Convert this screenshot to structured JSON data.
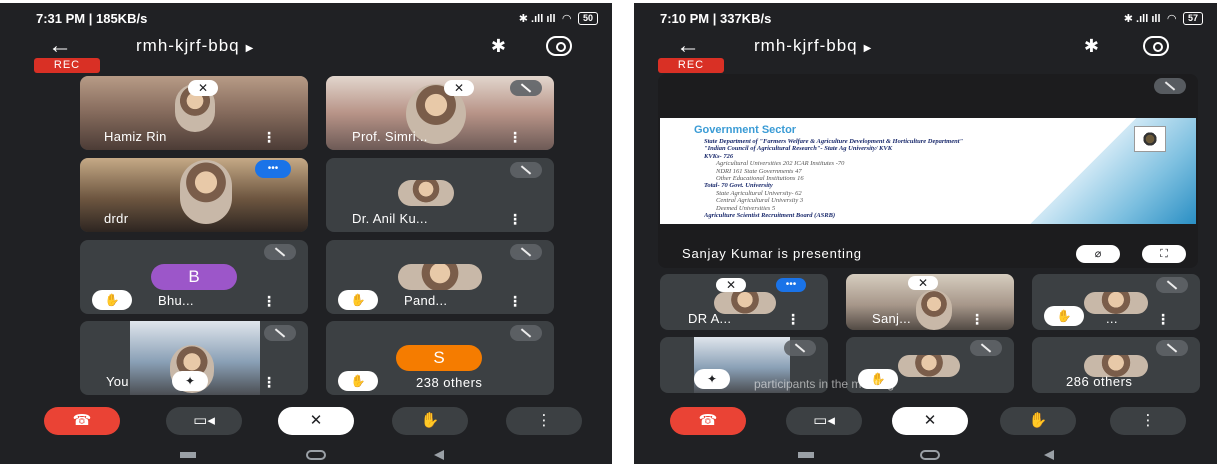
{
  "left_phone": {
    "status": {
      "time": "7:31 PM | 185KB/s",
      "network": "VoLTE",
      "battery": "50"
    },
    "header": {
      "meeting_code": "rmh-kjrf-bbq"
    },
    "rec_label": "REC",
    "tiles": [
      {
        "name": "Hamiz Rin"
      },
      {
        "name": "Prof. Simri..."
      },
      {
        "name": "drdr"
      },
      {
        "name": "Dr. Anil Ku..."
      },
      {
        "name": "Bhu...",
        "initial": "B"
      },
      {
        "name": "Pand..."
      },
      {
        "name": "You"
      },
      {
        "initial": "S",
        "others": "238 others"
      }
    ]
  },
  "right_phone": {
    "status": {
      "time": "7:10 PM | 337KB/s",
      "network": "VoLTE",
      "battery": "57"
    },
    "header": {
      "meeting_code": "rmh-kjrf-bbq"
    },
    "rec_label": "REC",
    "presentation": {
      "presenter_text": "Sanjay Kumar is presenting",
      "slide": {
        "title": "Government Sector",
        "lines": [
          {
            "text": "State Department of \"Farmers Welfare & Agriculture Development & Horticulture Department\"",
            "kind": "main"
          },
          {
            "text": "\"Indian Council of Agricultural Research\"- State Ag University/ KVK",
            "kind": "main"
          },
          {
            "text": "KVKs- 726",
            "kind": "main"
          },
          {
            "text": "Agricultural Universities 202     ICAR Institutes -70",
            "kind": "sub"
          },
          {
            "text": "NDRI 161                    State Governments 47",
            "kind": "sub"
          },
          {
            "text": "Other Educational Institutions 16",
            "kind": "sub"
          },
          {
            "text": "Total- 70 Govt. University",
            "kind": "main"
          },
          {
            "text": "State Agricultural University- 62",
            "kind": "sub"
          },
          {
            "text": "Central Agricultural University 3",
            "kind": "sub"
          },
          {
            "text": "Deemed Universities 5",
            "kind": "sub"
          },
          {
            "text": "Agriculture Scientist Recruitment Board (ASRB)",
            "kind": "main"
          }
        ]
      }
    },
    "tiles": [
      {
        "name": "DR A..."
      },
      {
        "name": "Sanj..."
      },
      {
        "name": "..."
      },
      {
        "name": ""
      },
      {
        "overlay": "participants in the meeting"
      },
      {
        "others": "286 others"
      }
    ]
  },
  "icons": {
    "back": "arrow-back-icon",
    "bluetooth": "bluetooth-icon",
    "switch_camera": "switch-camera-icon",
    "end_call": "end-call-icon",
    "camera": "camera-icon",
    "mic_off": "mic-off-icon",
    "raise_hand": "raise-hand-icon",
    "more": "more-vert-icon"
  },
  "colors": {
    "background": "#202124",
    "tile": "#3c4043",
    "rec": "#d93025",
    "end_call": "#ea4335",
    "avatar_b": "#9c56c9",
    "avatar_s": "#f57c00"
  }
}
